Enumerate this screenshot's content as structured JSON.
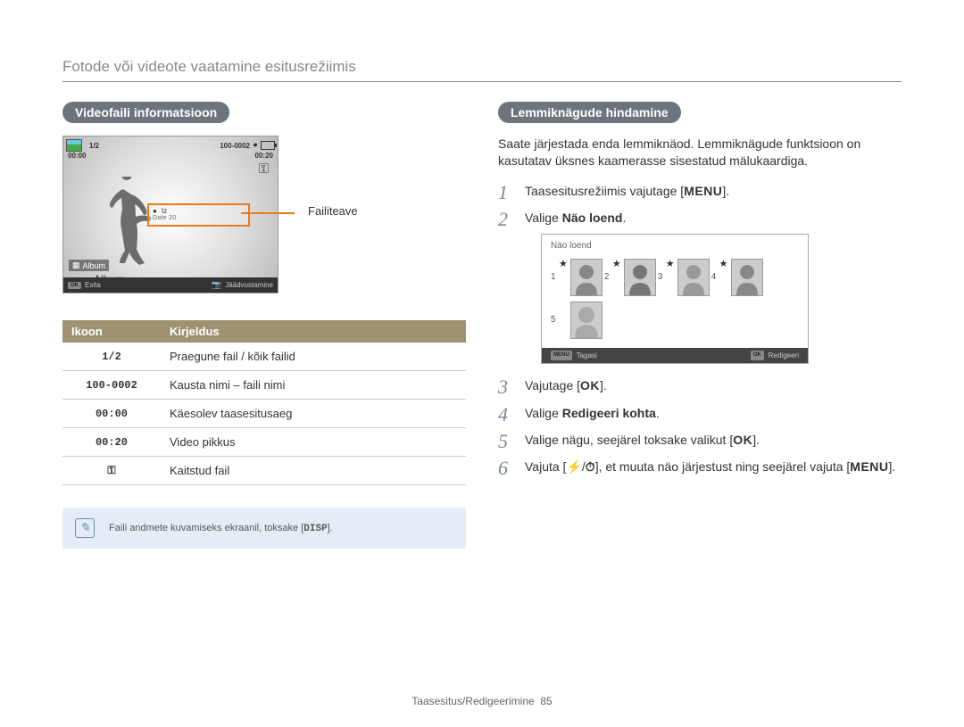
{
  "page_title": "Fotode või videote vaatamine esitusrežiimis",
  "left": {
    "section_title": "Videofaili informatsioon",
    "video": {
      "counter": "1/2",
      "file_number": "100-0002",
      "time_elapsed": "00:00",
      "time_total": "00:20",
      "album_label": "Album",
      "footer_play": "Esita",
      "footer_capture": "Jäädvustamine",
      "info_box": {
        "row1a": "Iz",
        "row2": "Date    20"
      }
    },
    "callout_label": "Failiteave",
    "table": {
      "headers": {
        "icon": "Ikoon",
        "desc": "Kirjeldus"
      },
      "rows": [
        {
          "icon": "1/2",
          "desc": "Praegune fail / kõik failid"
        },
        {
          "icon": "100-0002",
          "desc": "Kausta nimi – faili nimi"
        },
        {
          "icon": "00:00",
          "desc": "Käesolev taasesitusaeg"
        },
        {
          "icon": "00:20",
          "desc": "Video pikkus"
        },
        {
          "icon": "lock",
          "desc": "Kaitstud fail"
        }
      ]
    },
    "note": {
      "text_a": "Faili andmete kuvamiseks ekraanil, toksake [",
      "disp": "DISP",
      "text_b": "]."
    }
  },
  "right": {
    "section_title": "Lemmiknägude hindamine",
    "intro": "Saate järjestada enda lemmiknäod. Lemmiknägude funktsioon on kasutatav üksnes kaamerasse sisestatud mälukaardiga.",
    "steps": {
      "s1a": "Taasesitusrežiimis vajutage [",
      "s1menu": "MENU",
      "s1b": "].",
      "s2a": "Valige ",
      "s2b": "Näo loend",
      "s2c": ".",
      "s3a": "Vajutage [",
      "s3ok": "OK",
      "s3b": "].",
      "s4a": "Valige ",
      "s4b": "Redigeeri kohta",
      "s4c": ".",
      "s5a": "Valige nägu, seejärel toksake valikut [",
      "s5ok": "OK",
      "s5b": "].",
      "s6a": "Vajuta [",
      "s6flash": "⚡",
      "s6sep": "/",
      "s6timer": "⏱",
      "s6b": "], et muuta näo järjestust ning seejärel vajuta [",
      "s6menu": "MENU",
      "s6c": "]."
    },
    "face_screen": {
      "title": "Näo loend",
      "footer_back": "Tagasi",
      "footer_back_btn": "MENU",
      "footer_edit": "Redigeeri",
      "footer_edit_btn": "OK",
      "numbers": [
        "1",
        "2",
        "3",
        "4",
        "5"
      ]
    }
  },
  "footer": {
    "section": "Taasesitus/Redigeerimine",
    "page": "85"
  }
}
